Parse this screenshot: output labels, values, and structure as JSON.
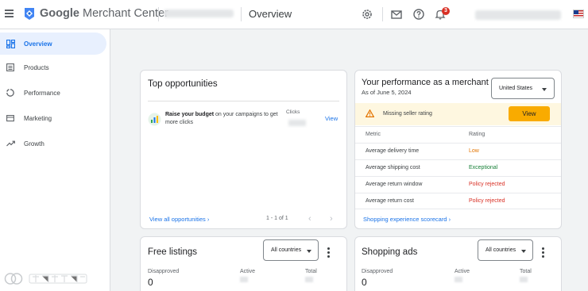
{
  "header": {
    "app_name_prefix": "Google",
    "app_name_suffix": "Merchant Center",
    "page_title": "Overview",
    "notification_count": "3",
    "icons": [
      "menu-icon",
      "merchant-center-logo",
      "gear-icon",
      "mail-icon",
      "help-icon",
      "bell-icon",
      "flag-icon"
    ]
  },
  "sidebar": {
    "items": [
      {
        "label": "Overview",
        "icon": "dashboard-icon",
        "active": true
      },
      {
        "label": "Products",
        "icon": "list-icon"
      },
      {
        "label": "Performance",
        "icon": "circle-chart-icon"
      },
      {
        "label": "Marketing",
        "icon": "marketing-icon"
      },
      {
        "label": "Growth",
        "icon": "trending-up-icon"
      }
    ]
  },
  "top_opportunities": {
    "title": "Top opportunities",
    "item_bold": "Raise your budget",
    "item_rest": " on your campaigns to get more clicks",
    "clicks_label": "Clicks",
    "view_link": "View",
    "view_all_link": "View all opportunities",
    "pager_text": "1 - 1 of 1"
  },
  "performance": {
    "title": "Your performance as a merchant",
    "as_of": "As of June 5, 2024",
    "country_selected": "United States",
    "alert_text": "Missing seller rating",
    "alert_button": "View",
    "col_metric": "Metric",
    "col_rating": "Rating",
    "rows": [
      {
        "metric": "Average delivery time",
        "rating": "Low",
        "color": "#e37400"
      },
      {
        "metric": "Average shipping cost",
        "rating": "Exceptional",
        "color": "#188038"
      },
      {
        "metric": "Average return window",
        "rating": "Policy rejected",
        "color": "#d93025"
      },
      {
        "metric": "Average return cost",
        "rating": "Policy rejected",
        "color": "#d93025"
      }
    ],
    "scorecard_link": "Shopping experience scorecard"
  },
  "free_listings": {
    "title": "Free listings",
    "country_selected": "All countries",
    "disapproved_label": "Disapproved",
    "disapproved_value": "0",
    "active_label": "Active",
    "total_label": "Total"
  },
  "shopping_ads": {
    "title": "Shopping ads",
    "country_selected": "All countries",
    "disapproved_label": "Disapproved",
    "disapproved_value": "0",
    "active_label": "Active",
    "total_label": "Total"
  },
  "colors": {
    "accent": "#1a73e8",
    "warning_button": "#f9ab00",
    "alert_background": "#fef7e0"
  }
}
